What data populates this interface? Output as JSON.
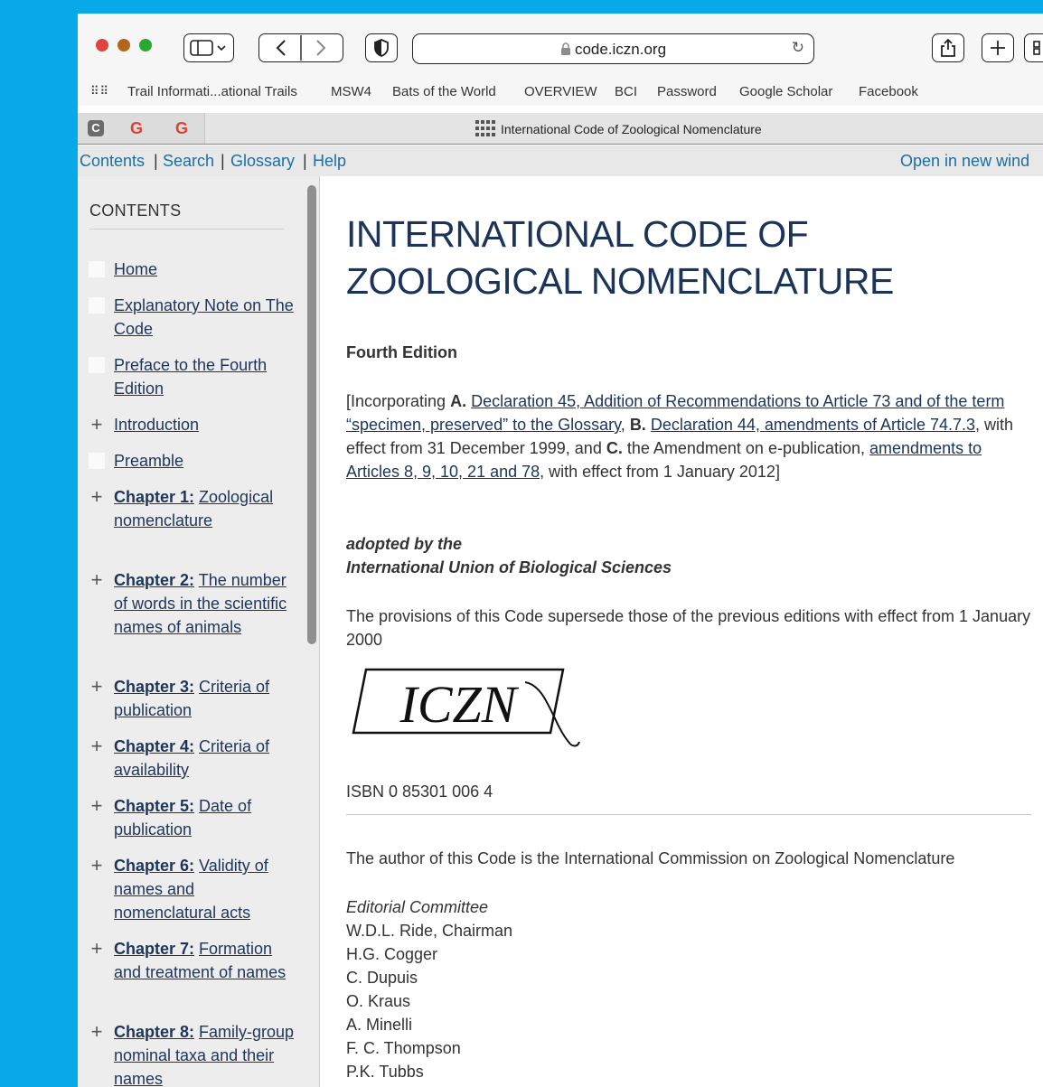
{
  "browser": {
    "url": "code.iczn.org",
    "bookmarks": [
      "Trail Informati...ational Trails",
      "MSW4",
      "Bats of the World",
      "OVERVIEW",
      "BCI",
      "Password",
      "Google Scholar",
      "Facebook"
    ],
    "active_tab_title": "International Code of Zoological Nomenclature",
    "pinned_tabs": [
      "C",
      "G",
      "G"
    ]
  },
  "site_nav": {
    "contents": "Contents",
    "search": "Search",
    "glossary": "Glossary",
    "help": "Help",
    "sep": "|",
    "open_new": "Open in new wind"
  },
  "sidebar": {
    "title": "CONTENTS",
    "items": [
      {
        "marker": "box",
        "strong": "",
        "label": "Home"
      },
      {
        "marker": "box",
        "strong": "",
        "label": "Explanatory Note on The Code"
      },
      {
        "marker": "box",
        "strong": "",
        "label": "Preface to the Fourth Edition"
      },
      {
        "marker": "plus",
        "strong": "",
        "label": "Introduction"
      },
      {
        "marker": "box",
        "strong": "",
        "label": "Preamble"
      },
      {
        "marker": "plus",
        "strong": "Chapter 1:",
        "label": "Zoological nomenclature"
      },
      {
        "marker": "plus",
        "strong": "Chapter 2:",
        "label": "The number of words in the scientific names of animals"
      },
      {
        "marker": "plus",
        "strong": "Chapter 3:",
        "label": "Criteria of publication"
      },
      {
        "marker": "plus",
        "strong": "Chapter 4:",
        "label": "Criteria of availability"
      },
      {
        "marker": "plus",
        "strong": "Chapter 5:",
        "label": "Date of publication"
      },
      {
        "marker": "plus",
        "strong": "Chapter 6:",
        "label": "Validity of names and nomenclatural acts"
      },
      {
        "marker": "plus",
        "strong": "Chapter 7:",
        "label": "Formation and treatment of names"
      },
      {
        "marker": "plus",
        "strong": "Chapter 8:",
        "label": "Family-group nominal taxa and their names"
      }
    ]
  },
  "main": {
    "title": "INTERNATIONAL CODE OF ZOOLOGICAL NOMENCLATURE",
    "edition": "Fourth Edition",
    "incorporating": {
      "intro": "[Incorporating ",
      "a_label": "A.",
      "a_link": "Declaration 45, Addition of Recommendations to Article 73 and of the term “specimen, preserved” to the Glossary",
      "comma1": ", ",
      "b_label": "B.",
      "b_link": "Declaration 44, amendments of Article 74.7.3",
      "mid": ", with effect from 31 December 1999, and ",
      "c_label": "C.",
      "c_text": " the Amendment on e-publication, ",
      "c_link": "amendments to Articles 8, 9, 10, 21 and 78",
      "end": ", with effect from 1  January 2012]"
    },
    "adopted_line1": "adopted by the",
    "adopted_line2": "International Union of Biological Sciences",
    "provisions": "The provisions of this Code supersede those of the previous editions with effect from 1 January 2000",
    "logo_text": "ICZN",
    "isbn": "ISBN 0 85301 006 4",
    "author": "The author of this Code is the International Commission on Zoological Nomenclature",
    "committee_heading": "Editorial Committee",
    "committee": [
      "W.D.L. Ride, Chairman",
      "H.G. Cogger",
      "C. Dupuis",
      "O. Kraus",
      "A. Minelli",
      "F. C. Thompson",
      "P.K. Tubbs"
    ]
  },
  "colors": {
    "desktop": "#08a9e8",
    "link": "#1b6fa0",
    "heading": "#1c3459"
  }
}
